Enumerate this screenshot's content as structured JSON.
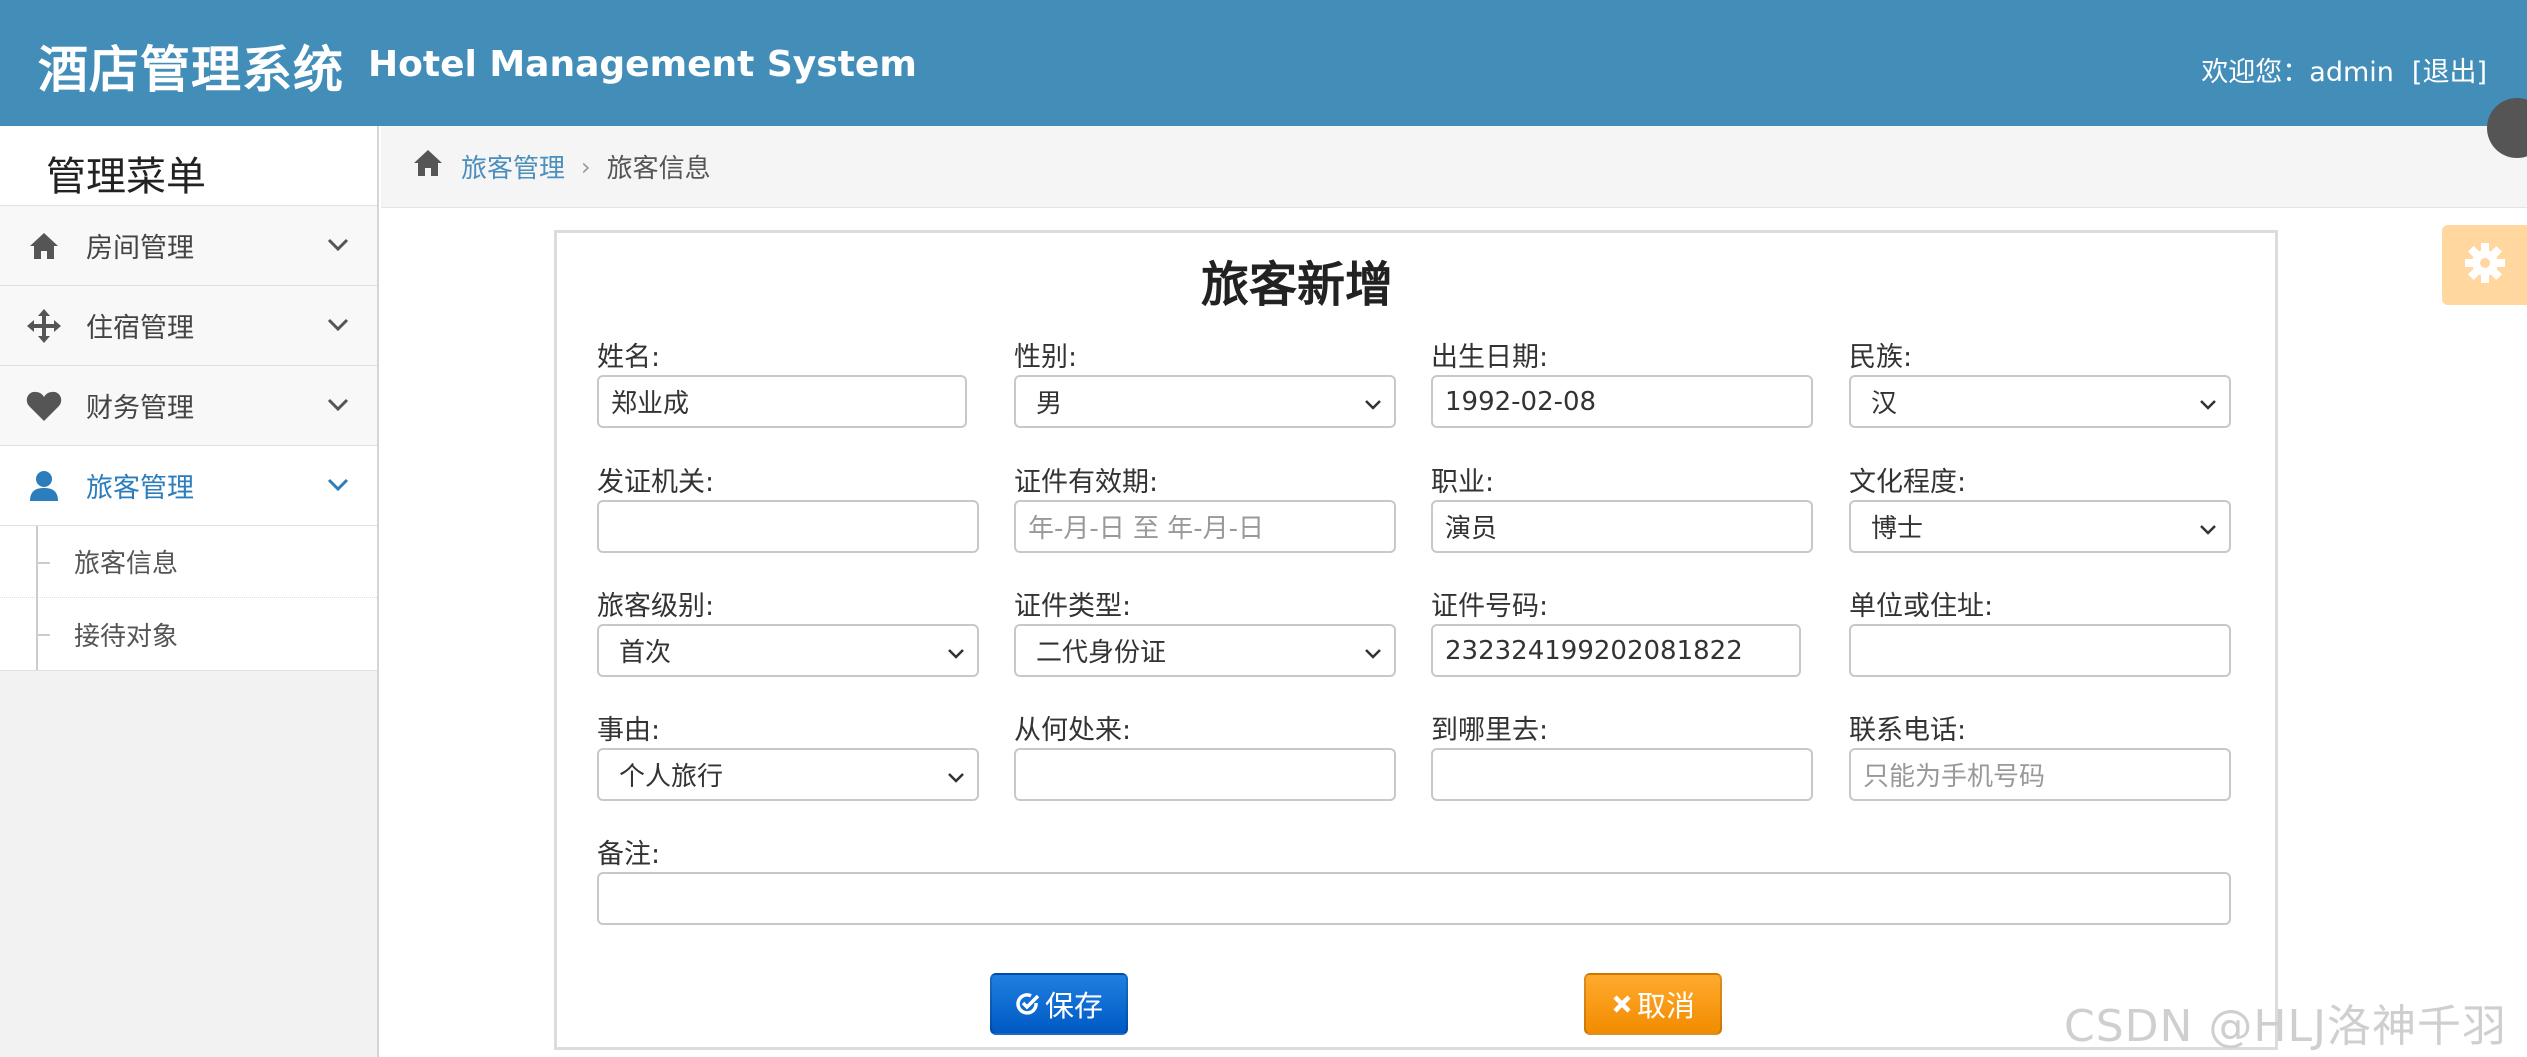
{
  "header": {
    "title_zh": "酒店管理系统",
    "title_en": "Hotel Management System",
    "welcome_text": "欢迎您：admin",
    "logout_label": "[退出]"
  },
  "sidebar": {
    "title": "管理菜单",
    "items": [
      {
        "label": "房间管理",
        "icon": "home-icon"
      },
      {
        "label": "住宿管理",
        "icon": "arrows-move-icon"
      },
      {
        "label": "财务管理",
        "icon": "heart-icon"
      },
      {
        "label": "旅客管理",
        "icon": "user-icon",
        "active": true
      }
    ],
    "subitems": [
      {
        "label": "旅客信息"
      },
      {
        "label": "接待对象"
      }
    ]
  },
  "breadcrumb": {
    "parent": "旅客管理",
    "current": "旅客信息"
  },
  "form": {
    "title": "旅客新增",
    "fields": {
      "name": {
        "label": "姓名:",
        "value": "郑业成"
      },
      "gender": {
        "label": "性别:",
        "value": "男"
      },
      "birth": {
        "label": "出生日期:",
        "value": "1992-02-08"
      },
      "ethnicity": {
        "label": "民族:",
        "value": "汉"
      },
      "issuer": {
        "label": "发证机关:",
        "value": ""
      },
      "validity": {
        "label": "证件有效期:",
        "placeholder": "年-月-日 至 年-月-日"
      },
      "occupation": {
        "label": "职业:",
        "value": "演员"
      },
      "education": {
        "label": "文化程度:",
        "value": "博士"
      },
      "level": {
        "label": "旅客级别:",
        "value": "首次"
      },
      "id_type": {
        "label": "证件类型:",
        "value": "二代身份证"
      },
      "id_number": {
        "label": "证件号码:",
        "value": "232324199202081822"
      },
      "address": {
        "label": "单位或住址:",
        "value": ""
      },
      "reason": {
        "label": "事由:",
        "value": "个人旅行"
      },
      "from": {
        "label": "从何处来:",
        "value": ""
      },
      "to": {
        "label": "到哪里去:",
        "value": ""
      },
      "phone": {
        "label": "联系电话:",
        "placeholder": "只能为手机号码"
      },
      "remark": {
        "label": "备注:",
        "value": ""
      }
    },
    "save_label": "保存",
    "cancel_label": "取消"
  },
  "watermark": "CSDN @HLJ洛神千羽",
  "colors": {
    "header_bg": "#438eb9",
    "active_menu": "#2b7dbc",
    "save_button": "#0b6fd6",
    "cancel_button": "#f7a11a"
  }
}
